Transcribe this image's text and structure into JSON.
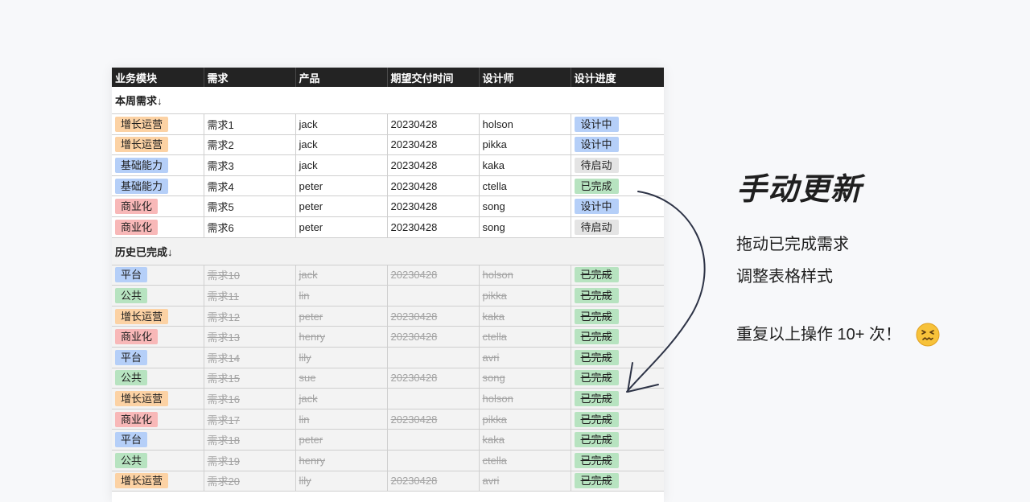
{
  "table": {
    "headers": [
      "业务模块",
      "需求",
      "产品",
      "期望交付时间",
      "设计师",
      "设计进度"
    ],
    "section_current": "本周需求↓",
    "section_history": "历史已完成↓",
    "current_rows": [
      {
        "module": "增长运营",
        "module_type": "growth",
        "req": "需求1",
        "product": "jack",
        "date": "20230428",
        "designer": "holson",
        "status": "设计中",
        "status_type": "design"
      },
      {
        "module": "增长运营",
        "module_type": "growth",
        "req": "需求2",
        "product": "jack",
        "date": "20230428",
        "designer": "pikka",
        "status": "设计中",
        "status_type": "design"
      },
      {
        "module": "基础能力",
        "module_type": "basic",
        "req": "需求3",
        "product": "jack",
        "date": "20230428",
        "designer": "kaka",
        "status": "待启动",
        "status_type": "pending"
      },
      {
        "module": "基础能力",
        "module_type": "basic",
        "req": "需求4",
        "product": "peter",
        "date": "20230428",
        "designer": "ctella",
        "status": "已完成",
        "status_type": "complete"
      },
      {
        "module": "商业化",
        "module_type": "business",
        "req": "需求5",
        "product": "peter",
        "date": "20230428",
        "designer": "song",
        "status": "设计中",
        "status_type": "design"
      },
      {
        "module": "商业化",
        "module_type": "business",
        "req": "需求6",
        "product": "peter",
        "date": "20230428",
        "designer": "song",
        "status": "待启动",
        "status_type": "pending"
      }
    ],
    "history_rows": [
      {
        "module": "平台",
        "module_type": "platform",
        "req": "需求10",
        "product": "jack",
        "date": "20230428",
        "designer": "holson",
        "status": "已完成"
      },
      {
        "module": "公共",
        "module_type": "public",
        "req": "需求11",
        "product": "lin",
        "date": "",
        "designer": "pikka",
        "status": "已完成"
      },
      {
        "module": "增长运营",
        "module_type": "growth",
        "req": "需求12",
        "product": "peter",
        "date": "20230428",
        "designer": "kaka",
        "status": "已完成"
      },
      {
        "module": "商业化",
        "module_type": "business",
        "req": "需求13",
        "product": "henry",
        "date": "20230428",
        "designer": "ctella",
        "status": "已完成"
      },
      {
        "module": "平台",
        "module_type": "platform",
        "req": "需求14",
        "product": "lily",
        "date": "",
        "designer": "avri",
        "status": "已完成"
      },
      {
        "module": "公共",
        "module_type": "public",
        "req": "需求15",
        "product": "sue",
        "date": "20230428",
        "designer": "song",
        "status": "已完成"
      },
      {
        "module": "增长运营",
        "module_type": "growth",
        "req": "需求16",
        "product": "jack",
        "date": "",
        "designer": "holson",
        "status": "已完成"
      },
      {
        "module": "商业化",
        "module_type": "business",
        "req": "需求17",
        "product": "lin",
        "date": "20230428",
        "designer": "pikka",
        "status": "已完成"
      },
      {
        "module": "平台",
        "module_type": "platform",
        "req": "需求18",
        "product": "peter",
        "date": "",
        "designer": "kaka",
        "status": "已完成"
      },
      {
        "module": "公共",
        "module_type": "public",
        "req": "需求19",
        "product": "henry",
        "date": "",
        "designer": "ctella",
        "status": "已完成"
      },
      {
        "module": "增长运营",
        "module_type": "growth",
        "req": "需求20",
        "product": "lily",
        "date": "20230428",
        "designer": "avri",
        "status": "已完成"
      }
    ]
  },
  "annotation": {
    "title": "手动更新",
    "line1": "拖动已完成需求",
    "line2": "调整表格样式",
    "repeat": "重复以上操作 10+ 次！",
    "emoji_icon": "confounded-face-icon"
  },
  "colors": {
    "header_bg": "#232323",
    "growth_tag": "#fcd2a4",
    "basic_tag": "#b5cff8",
    "business_tag": "#f8b8b8",
    "public_tag": "#b7e3c0",
    "status_design": "#b5cff8",
    "status_pending": "#e4e4e4",
    "status_complete": "#b7e3c0",
    "arrow": "#2d3346"
  }
}
